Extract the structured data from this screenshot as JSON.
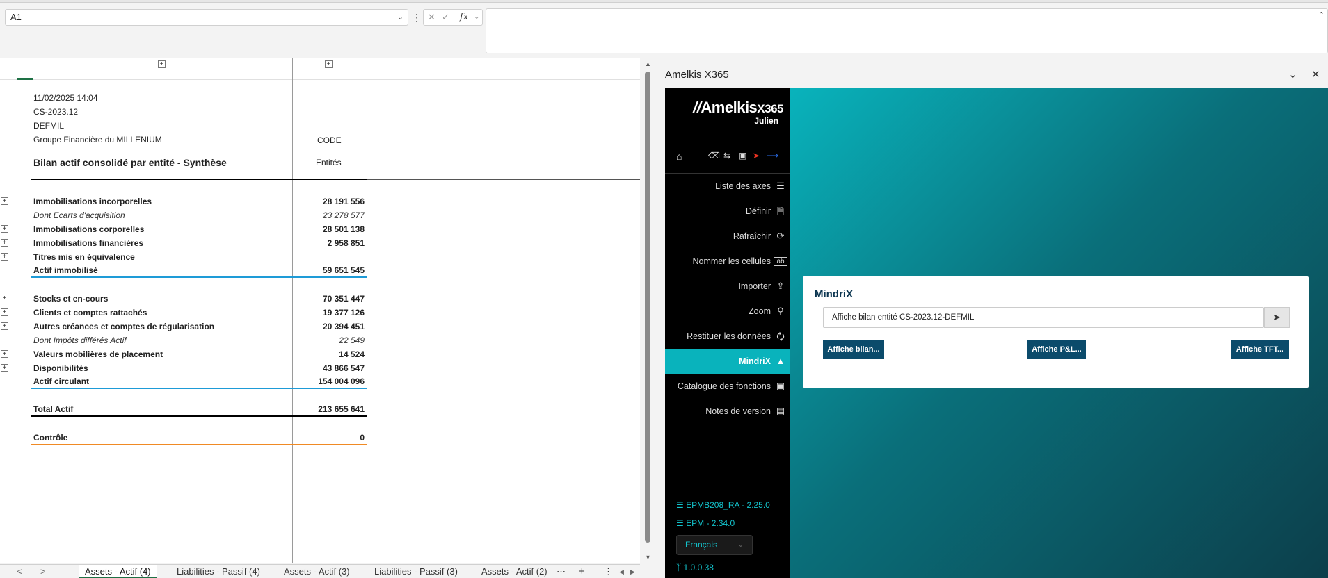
{
  "formula_bar": {
    "name_box": "A1",
    "fx_label": "fx",
    "formula": ""
  },
  "sheet": {
    "header": {
      "date": "11/02/2025 14:04",
      "scenario": "CS-2023.12",
      "entity": "DEFMIL",
      "group": "Groupe Financière du MILLENIUM",
      "title": "Bilan actif consolidé par entité - Synthèse",
      "code_label": "CODE",
      "entities_label": "Entités"
    },
    "rows": [
      {
        "label": "Immobilisations incorporelles",
        "value": "28 191 556"
      },
      {
        "label": "Dont Ecarts d'acquisition",
        "value": "23 278 577"
      },
      {
        "label": "Immobilisations corporelles",
        "value": "28 501 138"
      },
      {
        "label": "Immobilisations financières",
        "value": "2 958 851"
      },
      {
        "label": "Titres mis en équivalence",
        "value": ""
      },
      {
        "label": "Actif immobilisé",
        "value": "59 651 545"
      },
      {
        "label": "Stocks et en-cours",
        "value": "70 351 447"
      },
      {
        "label": "Clients et comptes rattachés",
        "value": "19 377 126"
      },
      {
        "label": "Autres créances et comptes de régularisation",
        "value": "20 394 451"
      },
      {
        "label": "Dont Impôts différés Actif",
        "value": "22 549"
      },
      {
        "label": "Valeurs mobilières de placement",
        "value": "14 524"
      },
      {
        "label": "Disponibilités",
        "value": "43 866 547"
      },
      {
        "label": "Actif circulant",
        "value": "154 004 096"
      },
      {
        "label": "Total Actif",
        "value": "213 655 641"
      },
      {
        "label": "Contrôle",
        "value": "0"
      }
    ],
    "tabs": [
      "Assets - Actif (4)",
      "Liabilities - Passif (4)",
      "Assets - Actif (3)",
      "Liabilities - Passif (3)",
      "Assets - Actif (2)"
    ],
    "colors": {
      "blue_rule": "#1e9bd7",
      "orange_rule": "#f08a24",
      "black_rule": "#000000"
    }
  },
  "pane": {
    "title": "Amelkis X365",
    "brand": {
      "name": "Amelkis",
      "suffix": "X365",
      "user": "Julien"
    },
    "menu": [
      {
        "label": "Liste des axes",
        "icon": "list-icon"
      },
      {
        "label": "Définir",
        "icon": "define-icon"
      },
      {
        "label": "Rafraîchir",
        "icon": "refresh-icon"
      },
      {
        "label": "Nommer les cellules",
        "icon": "name-cells-icon"
      },
      {
        "label": "Importer",
        "icon": "upload-icon"
      },
      {
        "label": "Zoom",
        "icon": "zoom-icon"
      },
      {
        "label": "Restituer les données",
        "icon": "restore-icon"
      },
      {
        "label": "MindriX",
        "icon": "mindrix-icon"
      },
      {
        "label": "Catalogue des fonctions",
        "icon": "folder-icon"
      },
      {
        "label": "Notes de version",
        "icon": "notes-icon"
      }
    ],
    "active_menu": "MindriX",
    "versions": [
      "EPMB208_RA - 2.25.0",
      "EPM - 2.34.0"
    ],
    "language": "Français",
    "build": "1.0.0.38",
    "mindrix": {
      "title": "MindriX",
      "prompt": "Affiche bilan entité CS-2023.12-DEFMIL",
      "buttons": [
        "Affiche bilan...",
        "Affiche P&L...",
        "Affiche TFT..."
      ]
    },
    "colors": {
      "accent": "#09b3bc",
      "button": "#0b4b6b"
    }
  }
}
